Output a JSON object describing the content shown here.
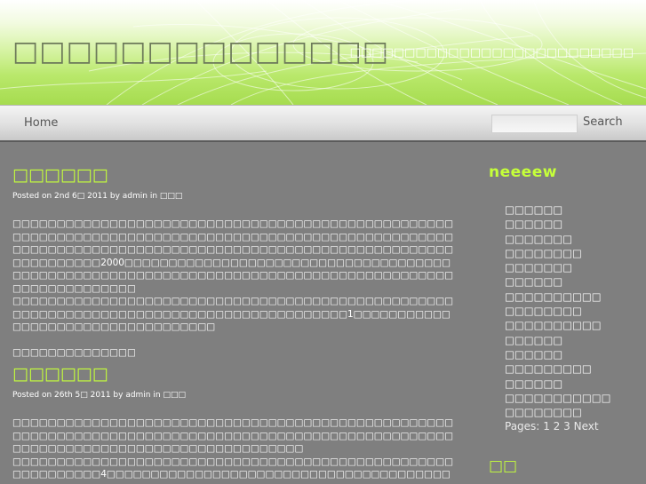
{
  "header": {
    "site_title": "□□□□□□□□□□□□□□",
    "site_description": "□□□□□□□□□□□□□□□□□□□□□□□□□□"
  },
  "nav": {
    "home_label": "Home",
    "search_placeholder": "",
    "search_button_label": "Search"
  },
  "posts": [
    {
      "title": "□□□□□□",
      "meta_prefix": "Posted on 2nd 6□ 2011 by admin in",
      "category": "□□□",
      "paragraphs": [
        "□□□□□□□□□□□□□□□□□□□□□□□□□□□□□□□□□□□□□□□□□□□□□□□□□□□□□□□□□□□□□□□□□□□□□□□□□□□□□□□□□□□□□□□□□□□□□□□□□□□□□□□□□□□□□□□□□□□□□□□□□□□□□□□□□□□□□□□□□□□□□□□□□□□□□□□□□□□□□□□□2000□□□□□□□□□□□□□□□□□□□□□□□□□□□□□□□□□□□□□□□□□□□□□□□□□□□□□□□□□□□□□□□□□□□□□□□□□□□□□□□□□□□□□□□□□□□□□□□□□□□□□",
        "□□□□□□□□□□□□□□□□□□□□□□□□□□□□□□□□□□□□□□□□□□□□□□□□□□□□□□□□□□□□□□□□□□□□□□□□□□□□□□□□□□□□□□□□1□□□□□□□□□□□□□□□□□□□□□□□□□□□□□□□□□□",
        "□□□□□□□□□□□□□□"
      ]
    },
    {
      "title": "□□□□□□",
      "meta_prefix": "Posted on 26th 5□ 2011 by admin in",
      "category": "□□□",
      "paragraphs": [
        "□□□□□□□□□□□□□□□□□□□□□□□□□□□□□□□□□□□□□□□□□□□□□□□□□□□□□□□□□□□□□□□□□□□□□□□□□□□□□□□□□□□□□□□□□□□□□□□□□□□□□□□□□□□□□□□□□□□□□□□□□□□□□□□□□□□□□",
        "□□□□□□□□□□□□□□□□□□□□□□□□□□□□□□□□□□□□□□□□□□□□□□□□□□□□□□□□□□□□4□□□□□□□□□□□□□□□□□□□□□□□□□□□□□□□□□□□□□□□□□□□□□□□□□□□□□□□□□□□□□□□□□□□□□□□□□□□□□□□□□□"
      ]
    }
  ],
  "sidebar": {
    "widget_title": "neeeew",
    "items": [
      "□□□□□□",
      "□□□□□□",
      "□□□□□□□",
      "□□□□□□□□",
      "□□□□□□□",
      "□□□□□□",
      "□□□□□□□□□□",
      "□□□□□□□□",
      "□□□□□□□□□□",
      "□□□□□□",
      "□□□□□□",
      "□□□□□□□□□",
      "□□□□□□",
      "□□□□□□□□□□□",
      "□□□□□□□□"
    ],
    "pages_label": "Pages:",
    "page_links": [
      "1",
      "2",
      "3"
    ],
    "next_label": "Next",
    "widget2_title": "□□"
  },
  "colors": {
    "accent_green": "#c5ff3a",
    "body_background": "#7f7f7f"
  }
}
